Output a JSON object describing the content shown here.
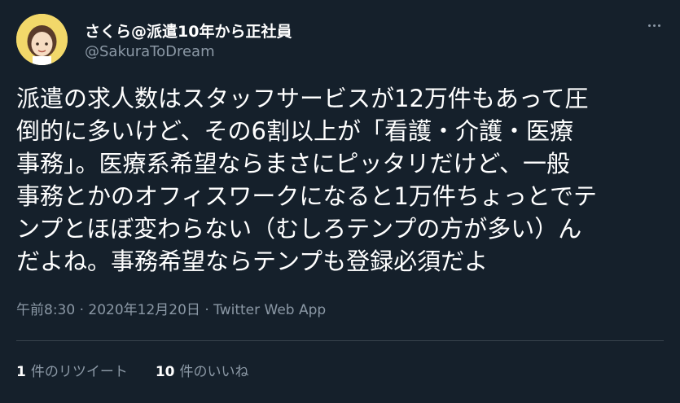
{
  "user": {
    "display_name": "さくら@派遣10年から正社員",
    "handle": "@SakuraToDream"
  },
  "tweet": {
    "lines": [
      "派遣の求人数はスタッフサービスが12万件もあって圧",
      "倒的に多いけど、その6割以上が「看護・介護・医療",
      "事務」。医療系希望ならまさにピッタリだけど、一般",
      "事務とかのオフィスワークになると1万件ちょっとでテ",
      "ンプとほぼ変わらない（むしろテンプの方が多い）ん",
      "だよね。事務希望ならテンプも登録必須だよ"
    ]
  },
  "meta": {
    "time": "午前8:30",
    "separator1": " · ",
    "date": "2020年12月20日",
    "separator2": " · ",
    "app": "Twitter Web App"
  },
  "stats": {
    "retweets_count": "1",
    "retweets_label": "件のリツイート",
    "likes_count": "10",
    "likes_label": "件のいいね"
  },
  "icons": {
    "avatar": "avatar-illustration",
    "more": "more-options-icon"
  },
  "colors": {
    "background": "#15202b",
    "secondary_text": "#8b98a5",
    "divider": "#38444d"
  }
}
